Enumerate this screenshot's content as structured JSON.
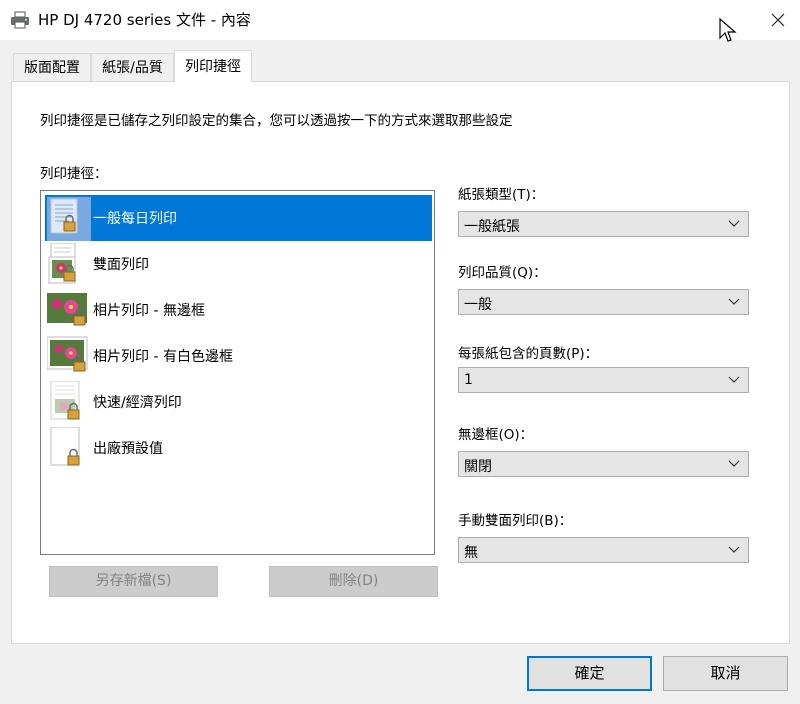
{
  "window": {
    "title": "HP DJ 4720 series 文件 - 內容",
    "close_glyph": "✕"
  },
  "tabs": [
    {
      "label": "版面配置",
      "active": false
    },
    {
      "label": "紙張/品質",
      "active": false
    },
    {
      "label": "列印捷徑",
      "active": true
    }
  ],
  "panel": {
    "description": "列印捷徑是已儲存之列印設定的集合，您可以透過按一下的方式來選取那些設定",
    "list_label": "列印捷徑：",
    "shortcuts": [
      {
        "label": "一般每日列印",
        "selected": true,
        "icon": "document-lock-icon"
      },
      {
        "label": "雙面列印",
        "selected": false,
        "icon": "duplex-flower-lock-icon"
      },
      {
        "label": "相片列印 - 無邊框",
        "selected": false,
        "icon": "photo-borderless-lock-icon"
      },
      {
        "label": "相片列印 - 有白色邊框",
        "selected": false,
        "icon": "photo-white-border-lock-icon"
      },
      {
        "label": "快速/經濟列印",
        "selected": false,
        "icon": "economy-document-lock-icon"
      },
      {
        "label": "出廠預設值",
        "selected": false,
        "icon": "blank-page-lock-icon"
      }
    ],
    "save_as_label": "另存新檔(S)",
    "delete_label": "刪除(D)",
    "fields": [
      {
        "label": "紙張類型(T)：",
        "value": "一般紙張"
      },
      {
        "label": "列印品質(Q)：",
        "value": "一般"
      },
      {
        "label": "每張紙包含的頁數(P)：",
        "value": "1"
      },
      {
        "label": "無邊框(O)：",
        "value": "關閉"
      },
      {
        "label": "手動雙面列印(B)：",
        "value": "無"
      }
    ]
  },
  "buttons": {
    "ok": "確定",
    "cancel": "取消"
  },
  "colors": {
    "selection": "#0078d7",
    "background": "#f0f0f0",
    "disabled_button": "#cccccc"
  }
}
